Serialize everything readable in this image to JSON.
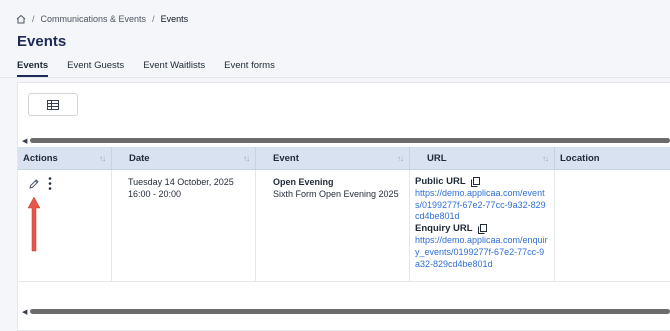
{
  "breadcrumb": {
    "home_icon": "home-icon",
    "items": [
      "Communications & Events",
      "Events"
    ],
    "separator": "/"
  },
  "page": {
    "title": "Events"
  },
  "tabs": [
    {
      "label": "Events",
      "active": true
    },
    {
      "label": "Event Guests",
      "active": false
    },
    {
      "label": "Event Waitlists",
      "active": false
    },
    {
      "label": "Event forms",
      "active": false
    }
  ],
  "toolbar": {
    "table_view_icon": "table-icon"
  },
  "table": {
    "columns": [
      "Actions",
      "Date",
      "Event",
      "URL",
      "Location"
    ],
    "rows": [
      {
        "date_line1": "Tuesday 14 October, 2025",
        "date_line2": "16:00 - 20:00",
        "event_title": "Open Evening",
        "event_subtitle": "Sixth Form Open Evening 2025",
        "public_url_label": "Public URL",
        "public_url": "https://demo.applicaa.com/events/0199277f-67e2-77cc-9a32-829cd4be801d",
        "enquiry_url_label": "Enquiry URL",
        "enquiry_url": "https://demo.applicaa.com/enquiry_events/0199277f-67e2-77cc-9a32-829cd4be801d",
        "location": ""
      }
    ]
  },
  "colors": {
    "title": "#1e2b5a",
    "header_bg": "#d9e2f1",
    "link": "#2f6fd6",
    "annotation_arrow": "#e8554a"
  }
}
